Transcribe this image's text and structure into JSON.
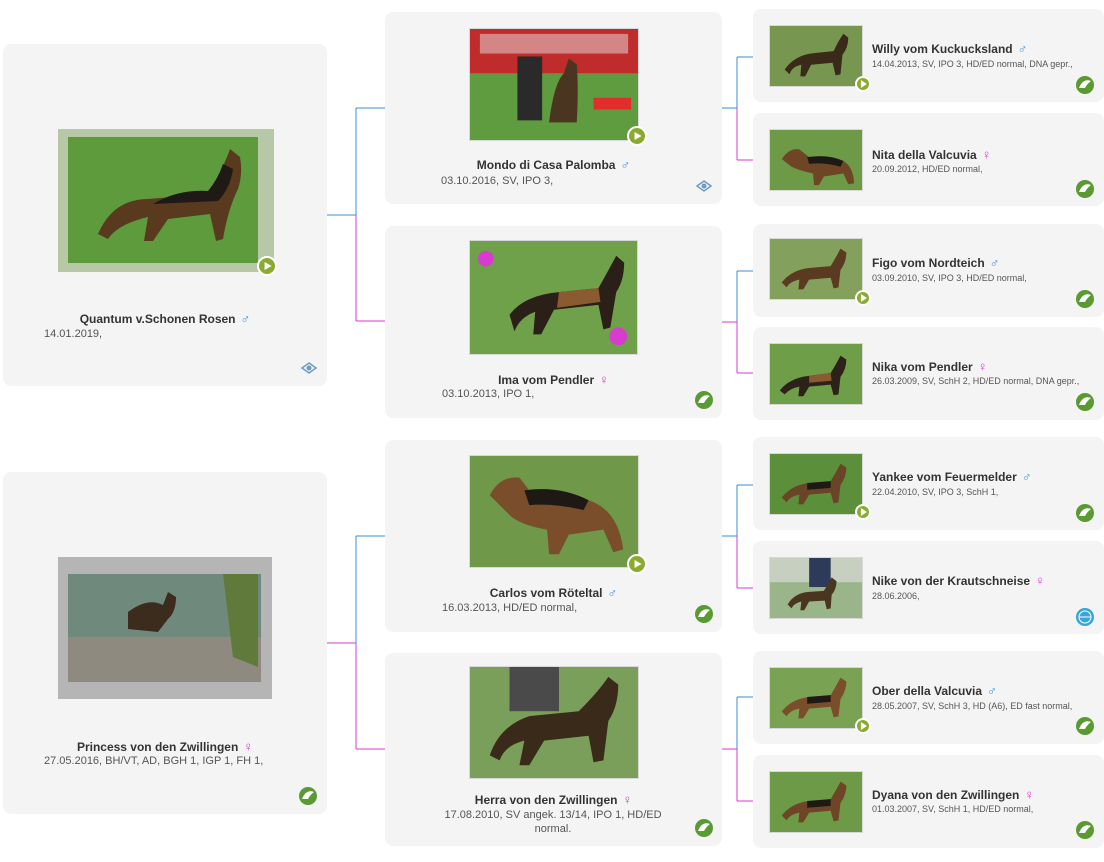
{
  "colors": {
    "card_bg": "#f4f4f4",
    "male_line": "#3a8fd6",
    "female_line": "#d83bd0",
    "play_button": "#8aab30",
    "badge_green": "#5a9a32"
  },
  "gen1": {
    "sire": {
      "name": "Quantum v.Schonen Rosen",
      "sex": "♂",
      "info": "14.01.2019,",
      "badge": "sv-emblem-icon"
    },
    "dam": {
      "name": "Princess von den Zwillingen",
      "sex": "♀",
      "info": "27.05.2016, BH/VT, AD, BGH 1, IGP 1, FH 1,",
      "badge": "breeder-leaf-icon"
    }
  },
  "gen2": [
    {
      "name": "Mondo di Casa Palomba",
      "sex": "♂",
      "info": "03.10.2016, SV, IPO 3,",
      "badge": "sv-emblem-icon"
    },
    {
      "name": "Ima vom Pendler",
      "sex": "♀",
      "info": "03.10.2013, IPO 1,",
      "badge": "breeder-leaf-icon"
    },
    {
      "name": "Carlos vom Röteltal",
      "sex": "♂",
      "info": "16.03.2013, HD/ED normal,",
      "badge": "breeder-leaf-icon"
    },
    {
      "name": "Herra von den Zwillingen",
      "sex": "♀",
      "info": "17.08.2010, SV angek. 13/14, IPO 1, HD/ED normal.",
      "badge": "breeder-leaf-icon"
    }
  ],
  "gen3": [
    {
      "name": "Willy vom Kuckucksland",
      "sex": "♂",
      "info": "14.04.2013, SV, IPO 3, HD/ED normal, DNA gepr.,",
      "badge": "breeder-leaf-icon"
    },
    {
      "name": "Nita della Valcuvia",
      "sex": "♀",
      "info": "20.09.2012, HD/ED normal,",
      "badge": "breeder-leaf-icon"
    },
    {
      "name": "Figo vom Nordteich",
      "sex": "♂",
      "info": "03.09.2010, SV, IPO 3, HD/ED normal,",
      "badge": "breeder-leaf-icon"
    },
    {
      "name": "Nika vom Pendler",
      "sex": "♀",
      "info": "26.03.2009, SV, SchH 2, HD/ED normal, DNA gepr.,",
      "badge": "breeder-leaf-icon"
    },
    {
      "name": "Yankee vom Feuermelder",
      "sex": "♂",
      "info": "22.04.2010, SV, IPO 3, SchH 1,",
      "badge": "breeder-leaf-icon"
    },
    {
      "name": "Nike von der Krautschneise",
      "sex": "♀",
      "info": "28.06.2006,",
      "badge": "globe-club-icon"
    },
    {
      "name": "Ober della Valcuvia",
      "sex": "♂",
      "info": "28.05.2007, SV, SchH 3, HD (A6), ED fast normal,",
      "badge": "breeder-leaf-icon"
    },
    {
      "name": "Dyana von den Zwillingen",
      "sex": "♀",
      "info": "01.03.2007, SV, SchH 1, HD/ED normal,",
      "badge": "breeder-leaf-icon"
    }
  ]
}
